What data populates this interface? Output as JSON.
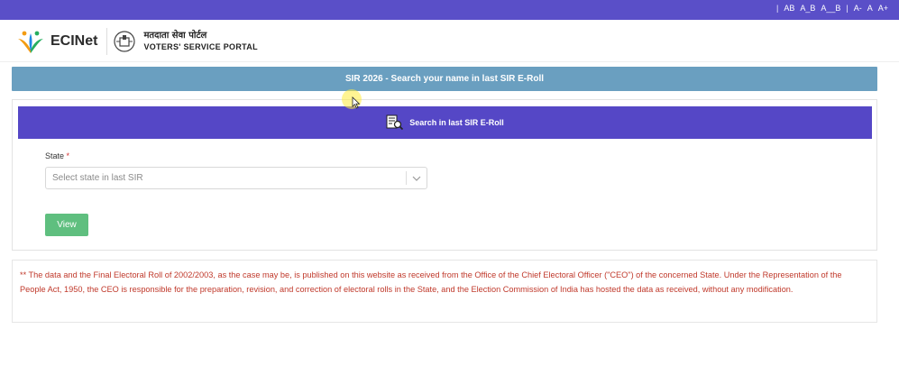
{
  "topbar": {
    "controls": [
      "AB",
      "A_B",
      "A__B",
      "A-",
      "A",
      "A+"
    ],
    "separator": "|",
    "color": "#5a4fc8"
  },
  "header": {
    "brand": "ECINet",
    "portal_hindi": "मतदाता सेवा पोर्टल",
    "portal_english": "VOTERS' SERVICE PORTAL"
  },
  "banner": {
    "title": "SIR 2026 - Search your name in last SIR E-Roll",
    "color": "#6a9fc0"
  },
  "search_card": {
    "header_title": "Search in last SIR E-Roll",
    "header_icon": "document-search-icon",
    "header_color": "#5547c6",
    "state_label": "State",
    "required_mark": "*",
    "select_placeholder": "Select state in last SIR",
    "view_button": "View",
    "view_button_color": "#5fbf7f"
  },
  "disclaimer": {
    "text": "** The data and the Final Electoral Roll of 2002/2003, as the case may be, is published on this website as received from the Office of the Chief Electoral Officer (\"CEO\") of the concerned State. Under the Representation of the People Act, 1950, the CEO is responsible for the preparation, revision, and correction of electoral rolls in the State, and the Election Commission of India has hosted the data as received, without any modification.",
    "color": "#c0392b"
  }
}
